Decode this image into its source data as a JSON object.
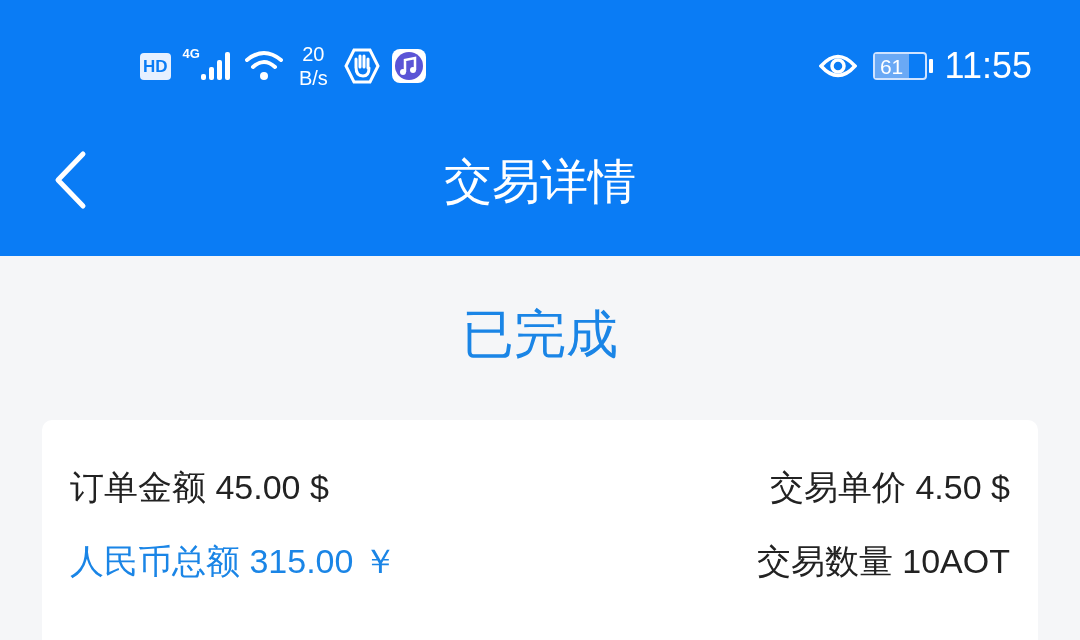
{
  "status_bar": {
    "hd": "HD",
    "network": "4G",
    "speed_value": "20",
    "speed_unit": "B/s",
    "battery": "61",
    "time": "11:55"
  },
  "header": {
    "title": "交易详情"
  },
  "order_status": "已完成",
  "details": [
    {
      "text": "订单金额 45.00 $",
      "highlighted": false
    },
    {
      "text": "交易单价 4.50 $",
      "highlighted": false
    },
    {
      "text": "人民币总额 315.00 ￥",
      "highlighted": true
    },
    {
      "text": "交易数量 10AOT",
      "highlighted": false
    }
  ]
}
